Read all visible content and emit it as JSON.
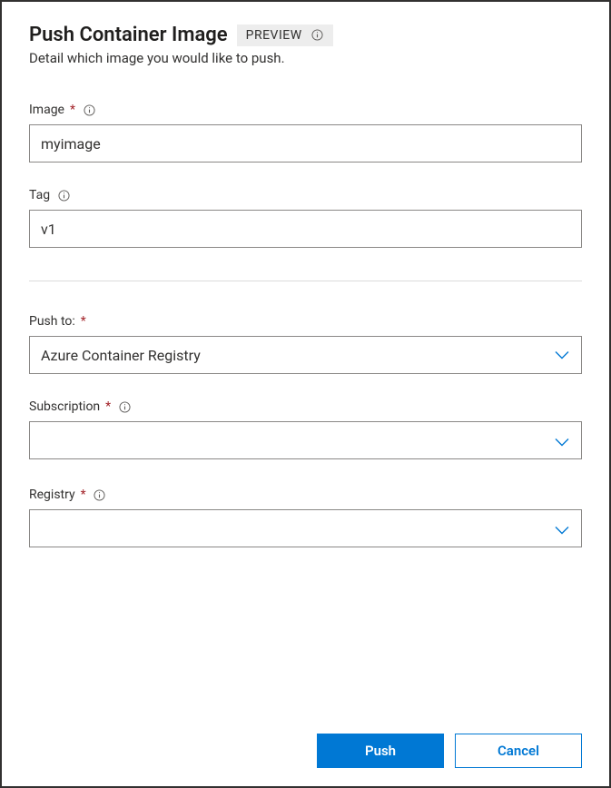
{
  "header": {
    "title": "Push Container Image",
    "badge": "PREVIEW",
    "subtitle": "Detail which image you would like to push."
  },
  "fields": {
    "image": {
      "label": "Image",
      "required": "*",
      "value": "myimage"
    },
    "tag": {
      "label": "Tag",
      "value": "v1"
    },
    "push_to": {
      "label": "Push to:",
      "required": "*",
      "value": "Azure Container Registry"
    },
    "subscription": {
      "label": "Subscription",
      "required": "*",
      "value": ""
    },
    "registry": {
      "label": "Registry",
      "required": "*",
      "value": ""
    }
  },
  "footer": {
    "push": "Push",
    "cancel": "Cancel"
  }
}
